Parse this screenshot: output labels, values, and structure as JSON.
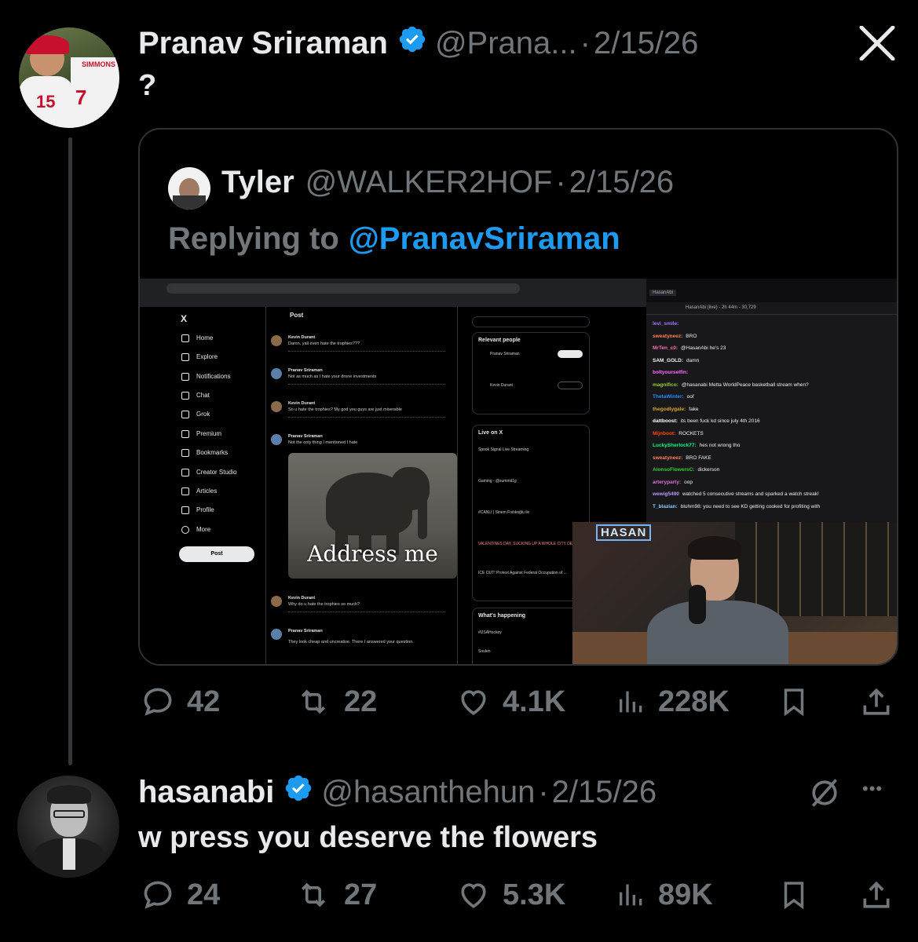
{
  "close_button": {
    "icon": "x-close-icon"
  },
  "tweet1": {
    "author_name": "Pranav Sriraman",
    "handle": "@Prana...",
    "separator": "·",
    "date": "2/15/26",
    "text": "?",
    "stats": {
      "replies": "42",
      "reposts": "22",
      "likes": "4.1K",
      "views": "228K"
    }
  },
  "quote": {
    "author_name": "Tyler",
    "handle": "@WALKER2HOF",
    "separator": "·",
    "date": "2/15/26",
    "replying_prefix": "Replying to",
    "replying_handle": "@PranavSriraman",
    "screenshot": {
      "feed_title": "Post",
      "nav": [
        "Home",
        "Explore",
        "Notifications",
        "Chat",
        "Grok",
        "Premium",
        "Bookmarks",
        "Creator Studio",
        "Articles",
        "Profile",
        "More"
      ],
      "post_button": "Post",
      "posts": [
        {
          "name": "Kevin Durant",
          "text": "Damn, yall even hate the trophies???"
        },
        {
          "name": "Pranav Sriraman",
          "text": "Not as much as I hate your drone investments"
        },
        {
          "name": "Kevin Durant",
          "text": "So u hate the trophies? My god you guys are just miserable"
        },
        {
          "name": "Pranav Sriraman",
          "text": "Not the only thing I mentioned I hate"
        },
        {
          "name": "Kevin Durant",
          "text": "Why do u hate the trophies so much?"
        },
        {
          "name": "Pranav Sriraman",
          "text": "They look cheap and uncreative. There I answered your question."
        }
      ],
      "gif_caption": "Address me",
      "relevant_title": "Relevant people",
      "relevant": [
        "Pranav Sriraman",
        "Kevin Durant"
      ],
      "live_title": "Live on X",
      "live": [
        "Spook Signal Live Streaming",
        "Gaming - @summit1g",
        "#CANLI | Sinem Fıstıkoğlu ile",
        "VALENTINES DAY, SUCKING UP A WHOLE CITY DEV",
        "ICE OUT! Protest Against Federal Occupation of ..."
      ],
      "happening_title": "What's happening",
      "happening": [
        "#USAHockey",
        "Soulen"
      ],
      "chat_header": "HasanAbi (live) - 2h 44m - 30,729",
      "chat_tab": "HasanAbi",
      "chat": [
        {
          "user": "levi_smile:",
          "msg": "",
          "color": "#a970ff"
        },
        {
          "user": "sweatyneez:",
          "msg": "BRO",
          "color": "#ff7f50"
        },
        {
          "user": "MrTen_c0:",
          "msg": "@HasanAbi he's 23",
          "color": "#ff69b4"
        },
        {
          "user": "SAM_GOLD:",
          "msg": "damn",
          "color": "#f5f5f5"
        },
        {
          "user": "boltyourselfin:",
          "msg": "",
          "color": "#ff6bff"
        },
        {
          "user": "magnifico:",
          "msg": "@hasanabi Metta WorldPeace basketball stream when?",
          "color": "#9acd32"
        },
        {
          "user": "ThetaWinter:",
          "msg": "oof",
          "color": "#1e90ff"
        },
        {
          "user": "thegodlygale:",
          "msg": "fake",
          "color": "#daa520"
        },
        {
          "user": "dattboost:",
          "msg": "its been fuck kd since july 4th 2016",
          "color": "#ffffff"
        },
        {
          "user": "Mijnboot:",
          "msg": "ROCKETS",
          "color": "#ff4500"
        },
        {
          "user": "LuckySherlock77:",
          "msg": "hes not wrong tho",
          "color": "#00ff7f"
        },
        {
          "user": "sweatyneez:",
          "msg": "BRO FAKE",
          "color": "#ff7f50"
        },
        {
          "user": "AlonsoFlowersC:",
          "msg": "dickerson",
          "color": "#32cd32"
        },
        {
          "user": "arteryparty:",
          "msg": "oop",
          "color": "#da70d6"
        },
        {
          "user": "wewig5490",
          "msg": "watched 5 consecutive streams and sparked a watch streak!",
          "color": "#bf94ff"
        },
        {
          "user": "T_blazian:",
          "msg": "bluhm98: you need to see KD getting cooked for profiting with",
          "color": "#87cefa"
        }
      ],
      "neon": "HASAN"
    }
  },
  "tweet2": {
    "author_name": "hasanabi",
    "handle": "@hasanthehun",
    "separator": "·",
    "date": "2/15/26",
    "text": "w press you deserve the flowers",
    "more_label": "•••",
    "stats": {
      "replies": "24",
      "reposts": "27",
      "likes": "5.3K",
      "views": "89K"
    }
  },
  "colors": {
    "background": "#000000",
    "text": "#e7e9ea",
    "muted": "#71767b",
    "accent": "#1d9bf0",
    "border": "#2f3336"
  }
}
